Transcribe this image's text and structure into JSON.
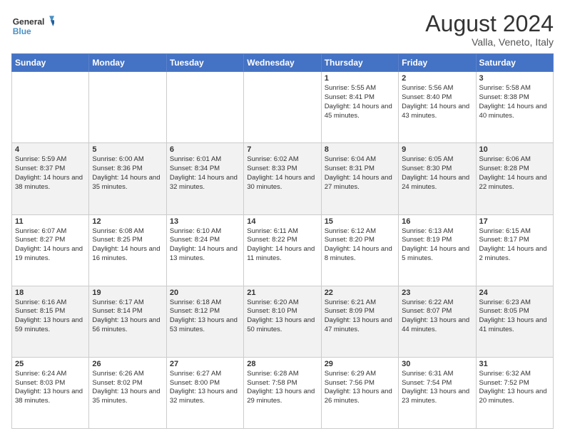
{
  "logo": {
    "text_general": "General",
    "text_blue": "Blue"
  },
  "header": {
    "title": "August 2024",
    "subtitle": "Valla, Veneto, Italy"
  },
  "calendar": {
    "days_of_week": [
      "Sunday",
      "Monday",
      "Tuesday",
      "Wednesday",
      "Thursday",
      "Friday",
      "Saturday"
    ],
    "weeks": [
      [
        {
          "day": "",
          "content": ""
        },
        {
          "day": "",
          "content": ""
        },
        {
          "day": "",
          "content": ""
        },
        {
          "day": "",
          "content": ""
        },
        {
          "day": "1",
          "content": "Sunrise: 5:55 AM\nSunset: 8:41 PM\nDaylight: 14 hours and 45 minutes."
        },
        {
          "day": "2",
          "content": "Sunrise: 5:56 AM\nSunset: 8:40 PM\nDaylight: 14 hours and 43 minutes."
        },
        {
          "day": "3",
          "content": "Sunrise: 5:58 AM\nSunset: 8:38 PM\nDaylight: 14 hours and 40 minutes."
        }
      ],
      [
        {
          "day": "4",
          "content": "Sunrise: 5:59 AM\nSunset: 8:37 PM\nDaylight: 14 hours and 38 minutes."
        },
        {
          "day": "5",
          "content": "Sunrise: 6:00 AM\nSunset: 8:36 PM\nDaylight: 14 hours and 35 minutes."
        },
        {
          "day": "6",
          "content": "Sunrise: 6:01 AM\nSunset: 8:34 PM\nDaylight: 14 hours and 32 minutes."
        },
        {
          "day": "7",
          "content": "Sunrise: 6:02 AM\nSunset: 8:33 PM\nDaylight: 14 hours and 30 minutes."
        },
        {
          "day": "8",
          "content": "Sunrise: 6:04 AM\nSunset: 8:31 PM\nDaylight: 14 hours and 27 minutes."
        },
        {
          "day": "9",
          "content": "Sunrise: 6:05 AM\nSunset: 8:30 PM\nDaylight: 14 hours and 24 minutes."
        },
        {
          "day": "10",
          "content": "Sunrise: 6:06 AM\nSunset: 8:28 PM\nDaylight: 14 hours and 22 minutes."
        }
      ],
      [
        {
          "day": "11",
          "content": "Sunrise: 6:07 AM\nSunset: 8:27 PM\nDaylight: 14 hours and 19 minutes."
        },
        {
          "day": "12",
          "content": "Sunrise: 6:08 AM\nSunset: 8:25 PM\nDaylight: 14 hours and 16 minutes."
        },
        {
          "day": "13",
          "content": "Sunrise: 6:10 AM\nSunset: 8:24 PM\nDaylight: 14 hours and 13 minutes."
        },
        {
          "day": "14",
          "content": "Sunrise: 6:11 AM\nSunset: 8:22 PM\nDaylight: 14 hours and 11 minutes."
        },
        {
          "day": "15",
          "content": "Sunrise: 6:12 AM\nSunset: 8:20 PM\nDaylight: 14 hours and 8 minutes."
        },
        {
          "day": "16",
          "content": "Sunrise: 6:13 AM\nSunset: 8:19 PM\nDaylight: 14 hours and 5 minutes."
        },
        {
          "day": "17",
          "content": "Sunrise: 6:15 AM\nSunset: 8:17 PM\nDaylight: 14 hours and 2 minutes."
        }
      ],
      [
        {
          "day": "18",
          "content": "Sunrise: 6:16 AM\nSunset: 8:15 PM\nDaylight: 13 hours and 59 minutes."
        },
        {
          "day": "19",
          "content": "Sunrise: 6:17 AM\nSunset: 8:14 PM\nDaylight: 13 hours and 56 minutes."
        },
        {
          "day": "20",
          "content": "Sunrise: 6:18 AM\nSunset: 8:12 PM\nDaylight: 13 hours and 53 minutes."
        },
        {
          "day": "21",
          "content": "Sunrise: 6:20 AM\nSunset: 8:10 PM\nDaylight: 13 hours and 50 minutes."
        },
        {
          "day": "22",
          "content": "Sunrise: 6:21 AM\nSunset: 8:09 PM\nDaylight: 13 hours and 47 minutes."
        },
        {
          "day": "23",
          "content": "Sunrise: 6:22 AM\nSunset: 8:07 PM\nDaylight: 13 hours and 44 minutes."
        },
        {
          "day": "24",
          "content": "Sunrise: 6:23 AM\nSunset: 8:05 PM\nDaylight: 13 hours and 41 minutes."
        }
      ],
      [
        {
          "day": "25",
          "content": "Sunrise: 6:24 AM\nSunset: 8:03 PM\nDaylight: 13 hours and 38 minutes."
        },
        {
          "day": "26",
          "content": "Sunrise: 6:26 AM\nSunset: 8:02 PM\nDaylight: 13 hours and 35 minutes."
        },
        {
          "day": "27",
          "content": "Sunrise: 6:27 AM\nSunset: 8:00 PM\nDaylight: 13 hours and 32 minutes."
        },
        {
          "day": "28",
          "content": "Sunrise: 6:28 AM\nSunset: 7:58 PM\nDaylight: 13 hours and 29 minutes."
        },
        {
          "day": "29",
          "content": "Sunrise: 6:29 AM\nSunset: 7:56 PM\nDaylight: 13 hours and 26 minutes."
        },
        {
          "day": "30",
          "content": "Sunrise: 6:31 AM\nSunset: 7:54 PM\nDaylight: 13 hours and 23 minutes."
        },
        {
          "day": "31",
          "content": "Sunrise: 6:32 AM\nSunset: 7:52 PM\nDaylight: 13 hours and 20 minutes."
        }
      ]
    ]
  }
}
